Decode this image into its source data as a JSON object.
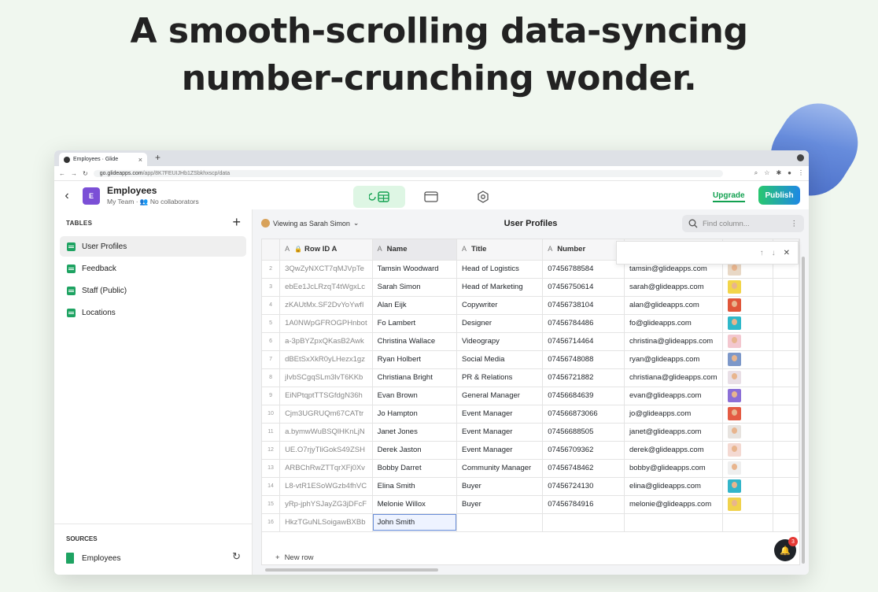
{
  "headline": {
    "line1": "A smooth-scrolling data-syncing",
    "line2": "number-crunching wonder."
  },
  "browser": {
    "tab_title": "Employees · Glide",
    "new_tab": "+",
    "url_host": "go.glideapps.com",
    "url_path": "/app/8K7FEUIJHb1ZSbkhxscp/data"
  },
  "app": {
    "icon_letter": "E",
    "title": "Employees",
    "team": "My Team",
    "collaborators": "No collaborators",
    "upgrade_label": "Upgrade",
    "publish_label": "Publish"
  },
  "sidebar": {
    "tables_header": "TABLES",
    "items": [
      {
        "label": "User Profiles"
      },
      {
        "label": "Feedback"
      },
      {
        "label": "Staff (Public)"
      },
      {
        "label": "Locations"
      }
    ],
    "sources_header": "SOURCES",
    "source_label": "Employees"
  },
  "main": {
    "viewing_as": "Viewing as Sarah Simon",
    "table_title": "User Profiles",
    "find_placeholder": "Find column...",
    "new_row_label": "New row",
    "notification_count": "3"
  },
  "table": {
    "type_letter": "A",
    "columns": [
      "Row ID A",
      "Name",
      "Title",
      "Number"
    ],
    "rows": [
      {
        "n": "2",
        "id": "3QwZyNXCT7qMJVpTe",
        "name": "Tamsin Woodward",
        "title": "Head of Logistics",
        "number": "07456788584",
        "email": "tamsin@glideapps.com",
        "face": "#e8d8c6"
      },
      {
        "n": "3",
        "id": "ebEe1JcLRzqT4tWgxLc",
        "name": "Sarah Simon",
        "title": "Head of Marketing",
        "number": "07456750614",
        "email": "sarah@glideapps.com",
        "face": "#f2d54a"
      },
      {
        "n": "4",
        "id": "zKAUtMx.SF2DvYoYwfI",
        "name": "Alan Eijk",
        "title": "Copywriter",
        "number": "07456738104",
        "email": "alan@glideapps.com",
        "face": "#e0563a"
      },
      {
        "n": "5",
        "id": "1A0NWpGFROGPHnbot",
        "name": "Fo Lambert",
        "title": "Designer",
        "number": "07456784486",
        "email": "fo@glideapps.com",
        "face": "#2fb8c9"
      },
      {
        "n": "6",
        "id": "a-3pBYZpxQKasB2Awk",
        "name": "Christina Wallace",
        "title": "Videograpy",
        "number": "07456714464",
        "email": "christina@glideapps.com",
        "face": "#f3c7cf"
      },
      {
        "n": "7",
        "id": "dBEtSxXkR0yLHezx1gz",
        "name": "Ryan Holbert",
        "title": "Social Media",
        "number": "07456748088",
        "email": "ryan@glideapps.com",
        "face": "#7d98c9"
      },
      {
        "n": "8",
        "id": "jIvbSCgqSLm3lvT6KKb",
        "name": "Christiana Bright",
        "title": "PR & Relations",
        "number": "07456721882",
        "email": "christiana@glideapps.com",
        "face": "#e9dfe6"
      },
      {
        "n": "9",
        "id": "EiNPtqptTTSGfdgN36h",
        "name": "Evan Brown",
        "title": "General Manager",
        "number": "07456684639",
        "email": "evan@glideapps.com",
        "face": "#8c6fd6"
      },
      {
        "n": "10",
        "id": "Cjm3UGRUQm67CATtr",
        "name": "Jo Hampton",
        "title": "Event Manager",
        "number": "074566873066",
        "email": "jo@glideapps.com",
        "face": "#e45b43"
      },
      {
        "n": "11",
        "id": "a.bymwWuBSQlHKnLjN",
        "name": "Janet Jones",
        "title": "Event Manager",
        "number": "07456688505",
        "email": "janet@glideapps.com",
        "face": "#e7e3df"
      },
      {
        "n": "12",
        "id": "UE.O7rjyTliGokS49ZSH",
        "name": "Derek Jaston",
        "title": "Event Manager",
        "number": "07456709362",
        "email": "derek@glideapps.com",
        "face": "#f4d9d2"
      },
      {
        "n": "13",
        "id": "ARBChRwZTTqrXFj0Xv",
        "name": "Bobby Darret",
        "title": "Community Manager",
        "number": "07456748462",
        "email": "bobby@glideapps.com",
        "face": "#efefef"
      },
      {
        "n": "14",
        "id": "L8-vtR1ESoWGzb4fhVC",
        "name": "Elina Smith",
        "title": "Buyer",
        "number": "07456724130",
        "email": "elina@glideapps.com",
        "face": "#33b5c9"
      },
      {
        "n": "15",
        "id": "yRp-jphYSJayZG3jDFcF",
        "name": "Melonie Willox",
        "title": "Buyer",
        "number": "07456784916",
        "email": "melonie@glideapps.com",
        "face": "#f0d24c"
      },
      {
        "n": "16",
        "id": "HkzTGuNLSoigawBXBb",
        "name": "John Smith",
        "title": "",
        "number": "",
        "email": "",
        "face": ""
      }
    ]
  }
}
